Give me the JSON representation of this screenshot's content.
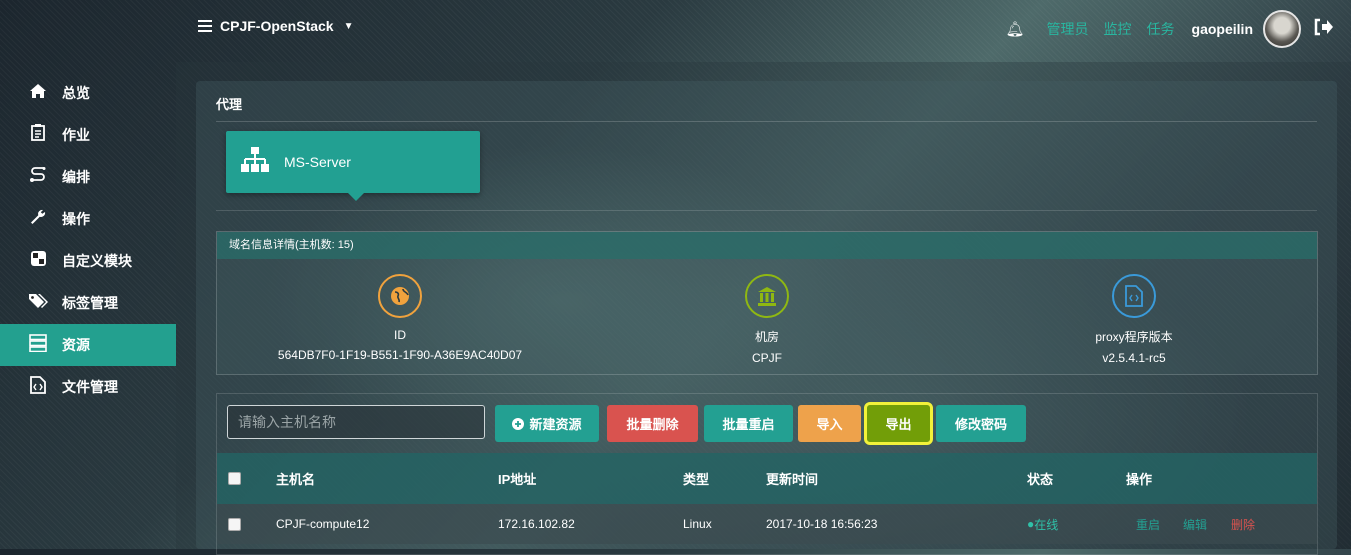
{
  "header": {
    "project": "CPJF-OpenStack",
    "links": [
      "管理员",
      "监控",
      "任务"
    ],
    "username": "gaopeilin"
  },
  "sidebar": {
    "items": [
      {
        "label": "总览",
        "icon": "home-icon"
      },
      {
        "label": "作业",
        "icon": "clipboard-icon"
      },
      {
        "label": "编排",
        "icon": "route-icon"
      },
      {
        "label": "操作",
        "icon": "wrench-icon"
      },
      {
        "label": "自定义模块",
        "icon": "module-icon"
      },
      {
        "label": "标签管理",
        "icon": "tags-icon"
      },
      {
        "label": "资源",
        "icon": "server-icon",
        "active": true
      },
      {
        "label": "文件管理",
        "icon": "file-code-icon"
      }
    ]
  },
  "panel": {
    "title": "代理",
    "card_label": "MS-Server"
  },
  "domain_info": {
    "header": "域名信息详情(主机数: 15)",
    "items": [
      {
        "label": "ID",
        "value": "564DB7F0-1F19-B551-1F90-A36E9AC40D07",
        "color": "#f0a23d",
        "icon": "globe-icon"
      },
      {
        "label": "机房",
        "value": "CPJF",
        "color": "#8fb812",
        "icon": "bank-icon"
      },
      {
        "label": "proxy程序版本",
        "value": "v2.5.4.1-rc5",
        "color": "#3a9ad9",
        "icon": "file-code-icon"
      }
    ]
  },
  "toolbar": {
    "search_placeholder": "请输入主机名称",
    "new_label": "新建资源",
    "batch_delete_label": "批量删除",
    "batch_restart_label": "批量重启",
    "import_label": "导入",
    "export_label": "导出",
    "change_pwd_label": "修改密码"
  },
  "table": {
    "columns": [
      "主机名",
      "IP地址",
      "类型",
      "更新时间",
      "状态",
      "操作"
    ],
    "rows": [
      {
        "hostname": "CPJF-compute12",
        "ip": "172.16.102.82",
        "type": "Linux",
        "updated": "2017-10-18 16:56:23",
        "status": "在线",
        "actions": [
          "重启",
          "编辑",
          "删除"
        ]
      }
    ]
  },
  "colors": {
    "accent": "#23a092",
    "danger": "#d9534f",
    "warning": "#eea24b",
    "export": "#729e08",
    "highlight": "#f2f23a"
  }
}
